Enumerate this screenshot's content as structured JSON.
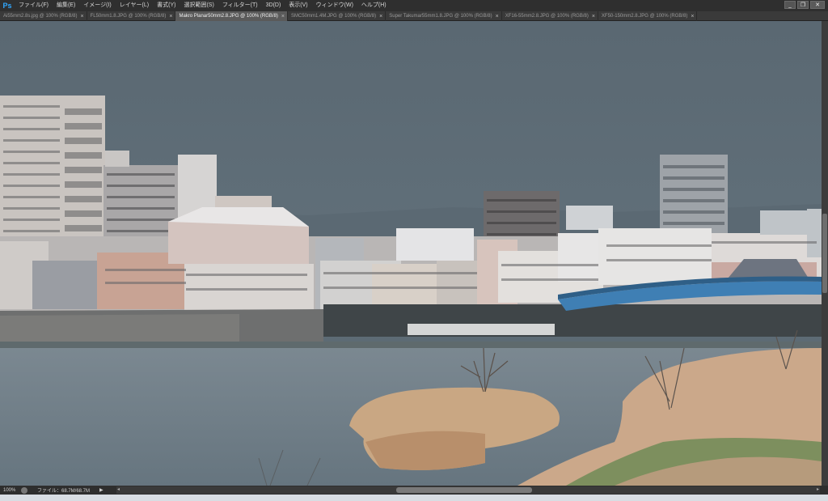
{
  "app": {
    "logo": "Ps",
    "menu": [
      "ファイル(F)",
      "編集(E)",
      "イメージ(I)",
      "レイヤー(L)",
      "書式(Y)",
      "選択範囲(S)",
      "フィルター(T)",
      "3D(D)",
      "表示(V)",
      "ウィンドウ(W)",
      "ヘルプ(H)"
    ],
    "window_controls": {
      "minimize": "_",
      "restore": "❐",
      "close": "✕"
    }
  },
  "tabs": [
    {
      "label": "Ai55mm2.8s.jpg @ 100% (RGB/8)",
      "active": false
    },
    {
      "label": "FL50mm1.8.JPG @ 100% (RGB/8)",
      "active": false
    },
    {
      "label": "Makro Planar50mm2.8.JPG @ 100% (RGB/8)",
      "active": true
    },
    {
      "label": "SMC50mm1.4M.JPG @ 100% (RGB/8)",
      "active": false
    },
    {
      "label": "Super Takumar55mm1.8.JPG @ 100% (RGB/8)",
      "active": false
    },
    {
      "label": "XF16-55mm2.8.JPG @ 100% (RGB/8)",
      "active": false
    },
    {
      "label": "XF50-150mm2.8.JPG @ 100% (RGB/8)",
      "active": false
    }
  ],
  "tab_close_glyph": "×",
  "status": {
    "zoom": "100%",
    "file_info": "ファイル：68.7M/68.7M",
    "arrow": "▶",
    "left_arrow": "◂",
    "right_arrow": "▸"
  },
  "colors": {
    "sky": "#5d6b75",
    "water": "#6d7c86",
    "bridge": "#3f7fb4",
    "reeds": "#c9a783",
    "grass": "#6f8a52",
    "accent_logo": "#31a8ff"
  }
}
